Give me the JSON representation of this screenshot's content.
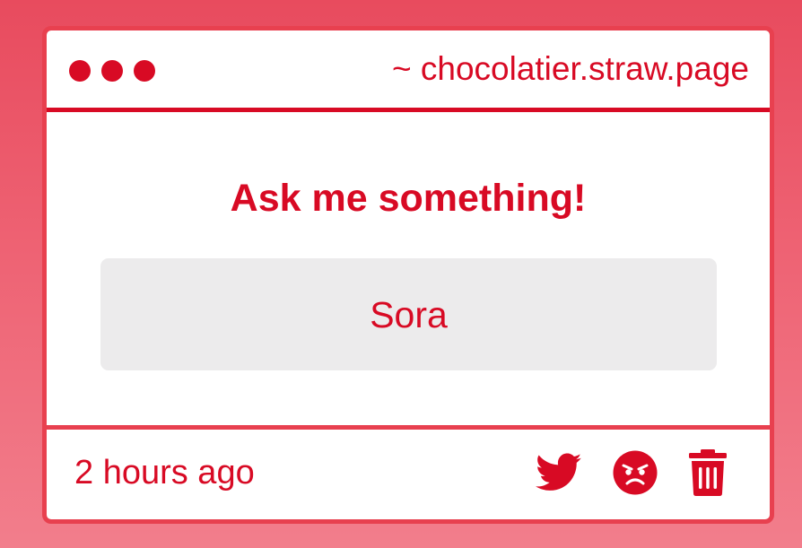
{
  "window": {
    "url": "~ chocolatier.straw.page"
  },
  "question": {
    "heading": "Ask me something!",
    "answer": "Sora"
  },
  "footer": {
    "timestamp": "2 hours ago",
    "actions": {
      "share_icon": "twitter-bird-icon",
      "report_icon": "angry-face-icon",
      "delete_icon": "trash-icon"
    }
  },
  "colors": {
    "accent": "#d80a24",
    "card_border": "#e8404f",
    "answer_background": "#ecebec",
    "page_background_top": "#e84b5e",
    "page_background_bottom": "#f27e8c"
  }
}
